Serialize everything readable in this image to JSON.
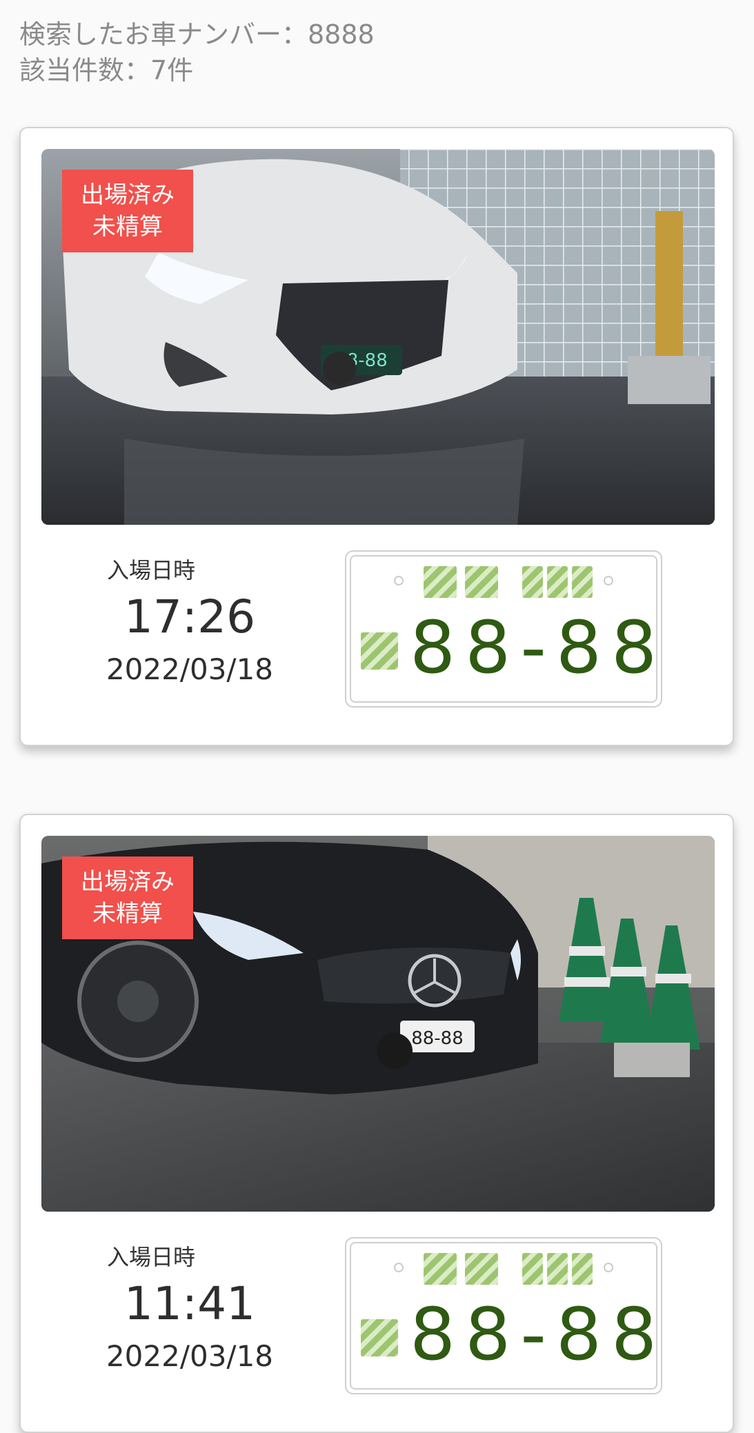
{
  "summary": {
    "search_label": "検索したお車ナンバー：8888",
    "count_label": "該当件数：7件"
  },
  "results": [
    {
      "status_line1": "出場済み",
      "status_line2": "未精算",
      "entry_label": "入場日時",
      "entry_time": "17:26",
      "entry_date": "2022/03/18",
      "plate_number": "88-88",
      "photo_plate_text": "88-88",
      "car_color": "white"
    },
    {
      "status_line1": "出場済み",
      "status_line2": "未精算",
      "entry_label": "入場日時",
      "entry_time": "11:41",
      "entry_date": "2022/03/18",
      "plate_number": "88-88",
      "photo_plate_text": "88-88",
      "car_color": "black"
    }
  ],
  "colors": {
    "badge": "#f1504c",
    "plate_text": "#2f5a12",
    "plate_stripe": "#9dc56f"
  }
}
